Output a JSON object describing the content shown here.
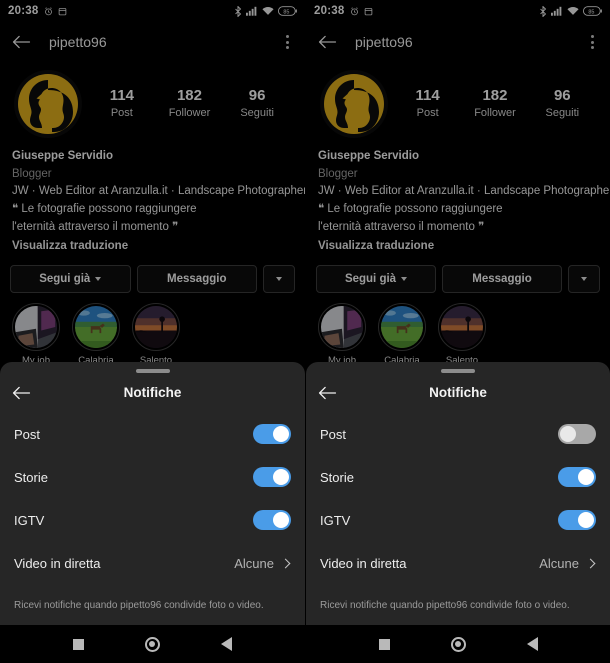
{
  "statusbar": {
    "time": "20:38",
    "left_icons": [
      "alarm-icon",
      "calendar-icon"
    ],
    "right_icons": [
      "bluetooth-icon",
      "signal-icon",
      "wifi-icon",
      "battery-icon"
    ],
    "battery_level": "85"
  },
  "appbar": {
    "back_icon": "back-arrow-icon",
    "title": "pipetto96",
    "menu_icon": "kebab-menu-icon"
  },
  "profile": {
    "avatar_name": "profile-avatar",
    "avatar_ring_color": "#d8a81c",
    "stats": [
      {
        "number": "114",
        "label": "Post"
      },
      {
        "number": "182",
        "label": "Follower"
      },
      {
        "number": "96",
        "label": "Seguiti"
      }
    ],
    "full_name": "Giuseppe Servidio",
    "category": "Blogger",
    "bio_lines": [
      "JW · Web Editor at Aranzulla.it · Landscape Photographer",
      "❝ Le fotografie possono raggiungere",
      "l'eternità attraverso il momento ❞"
    ],
    "translate_label": "Visualizza traduzione",
    "buttons": {
      "follow_label": "Segui già",
      "message_label": "Messaggio",
      "more_icon": "chevron-down-icon"
    },
    "highlights": [
      {
        "label": "My job",
        "thumb": "desk-laptop-photo"
      },
      {
        "label": "Calabria",
        "thumb": "horse-field-photo"
      },
      {
        "label": "Salento",
        "thumb": "sunset-silhouette-photo"
      }
    ]
  },
  "sheet": {
    "handle_name": "drag-handle",
    "back_icon": "back-arrow-icon",
    "title": "Notifiche",
    "live_row": {
      "label": "Video in diretta",
      "value": "Alcune",
      "chevron": "chevron-right-icon"
    },
    "footer": "Ricevi notifiche quando pipetto96 condivide foto o video.",
    "toggle_on_color": "#4a9ce8",
    "toggle_off_color": "#a8a8a8"
  },
  "panels": {
    "left": {
      "toggles": [
        {
          "label": "Post",
          "state": "on"
        },
        {
          "label": "Storie",
          "state": "on"
        },
        {
          "label": "IGTV",
          "state": "on"
        }
      ]
    },
    "right": {
      "toggles": [
        {
          "label": "Post",
          "state": "off"
        },
        {
          "label": "Storie",
          "state": "on"
        },
        {
          "label": "IGTV",
          "state": "on"
        }
      ]
    }
  },
  "navbar": {
    "recents_icon": "square-recents-icon",
    "home_icon": "circle-home-icon",
    "back_icon": "triangle-back-icon"
  }
}
